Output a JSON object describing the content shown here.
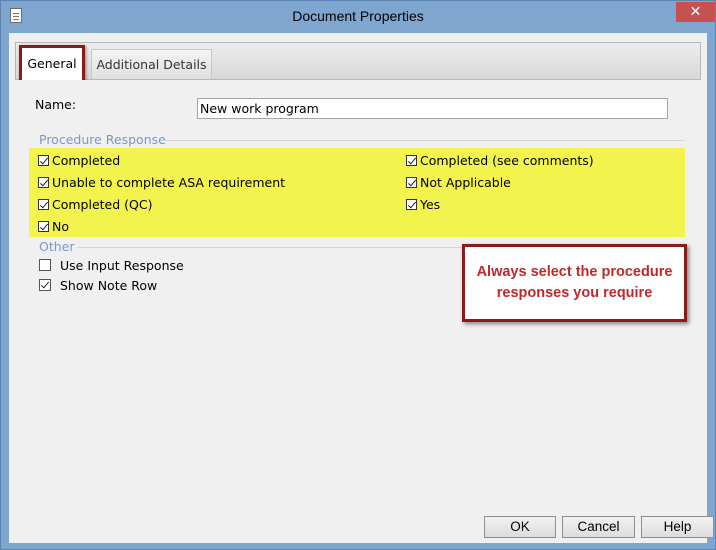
{
  "window": {
    "title": "Document Properties",
    "close_glyph": "✕"
  },
  "tabs": [
    {
      "label": "General"
    },
    {
      "label": "Additional Details"
    }
  ],
  "name_field": {
    "label": "Name:",
    "value": "New work program"
  },
  "procedure_response": {
    "heading": "Procedure Response",
    "left": [
      {
        "label": "Completed",
        "checked": true
      },
      {
        "label": "Unable to complete ASA requirement",
        "checked": true
      },
      {
        "label": "Completed (QC)",
        "checked": true
      },
      {
        "label": "No",
        "checked": true
      }
    ],
    "right": [
      {
        "label": "Completed (see comments)",
        "checked": true
      },
      {
        "label": "Not Applicable",
        "checked": true
      },
      {
        "label": "Yes",
        "checked": true
      }
    ]
  },
  "other": {
    "heading": "Other",
    "items": [
      {
        "label": "Use Input Response",
        "checked": false
      },
      {
        "label": "Show Note Row",
        "checked": true
      }
    ]
  },
  "callout": {
    "text": "Always select the procedure responses you require"
  },
  "buttons": {
    "ok": "OK",
    "cancel": "Cancel",
    "help": "Help"
  },
  "colors": {
    "highlight": "#f3f34e",
    "annotation_border": "#8b1a1a",
    "annotation_text": "#c0282b",
    "group_heading": "#7b97c7"
  }
}
